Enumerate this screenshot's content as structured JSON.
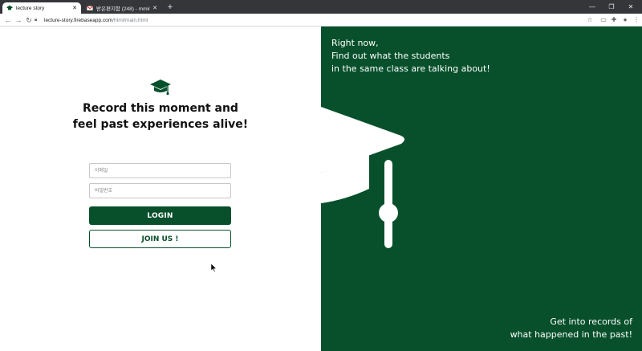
{
  "browser": {
    "tabs": [
      {
        "title": "lecture story",
        "active": true
      },
      {
        "title": "받은편지함 (248) - mminjg@...",
        "active": false
      }
    ],
    "new_tab": "+",
    "window_controls": {
      "minimize": "—",
      "maximize": "❐",
      "close": "✕"
    },
    "address": {
      "host": "lecture-story.firebaseapp.com",
      "path": "/html/main.html"
    }
  },
  "page": {
    "headline_line1": "Record this moment and",
    "headline_line2": "feel past experiences alive!",
    "email_placeholder": "이메일",
    "password_placeholder": "비밀번호",
    "login_label": "LOGIN",
    "join_label": "JOIN US !",
    "tagline_top": [
      "Right now,",
      "Find out what the students",
      "in the same class are talking about!"
    ],
    "tagline_bottom": [
      "Get into records of",
      "what happened in the past!"
    ]
  },
  "colors": {
    "brand_green": "#07502b",
    "white": "#ffffff"
  },
  "icons": {
    "hero": "graduation-cap-icon",
    "panel": "graduation-cap-icon"
  }
}
